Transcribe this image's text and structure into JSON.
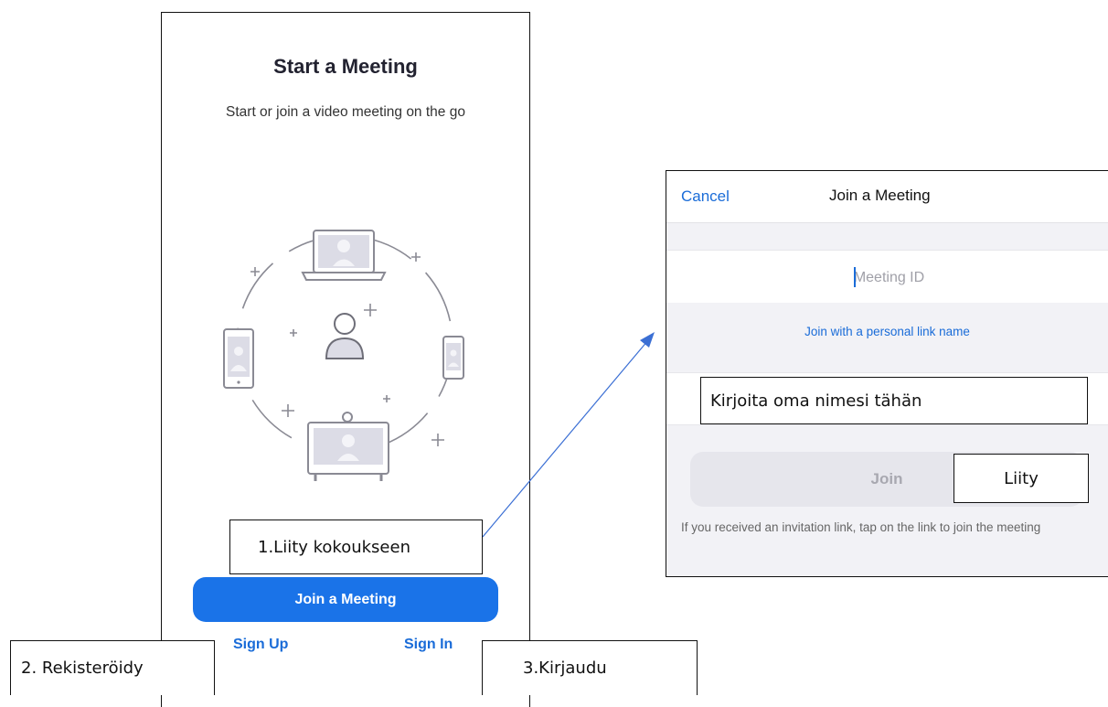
{
  "left_screen": {
    "title": "Start a Meeting",
    "subtitle": "Start or join a video meeting on the go",
    "join_button_label": "Join a Meeting",
    "sign_up_label": "Sign Up",
    "sign_in_label": "Sign In",
    "illustration_icons": [
      "laptop-icon",
      "tablet-icon",
      "phone-icon",
      "conference-screen-icon",
      "person-icon"
    ]
  },
  "dialog": {
    "cancel_label": "Cancel",
    "title": "Join a Meeting",
    "meeting_id_placeholder": "Meeting ID",
    "personal_link_label": "Join with a personal link name",
    "join_button_label": "Join",
    "invite_hint": "If you received an invitation link, tap on the link to join the meeting"
  },
  "annotations": {
    "join_meeting_note": "1.Liity kokoukseen",
    "name_note": "Kirjoita oma nimesi tähän",
    "join_note": "Liity",
    "register_note": "2. Rekisteröidy",
    "login_note": "3.Kirjaudu"
  },
  "colors": {
    "accent_blue": "#1a73e8",
    "link_blue": "#1a6cd8",
    "dialog_background": "#f2f2f6",
    "disabled_button": "#e6e6ec"
  }
}
